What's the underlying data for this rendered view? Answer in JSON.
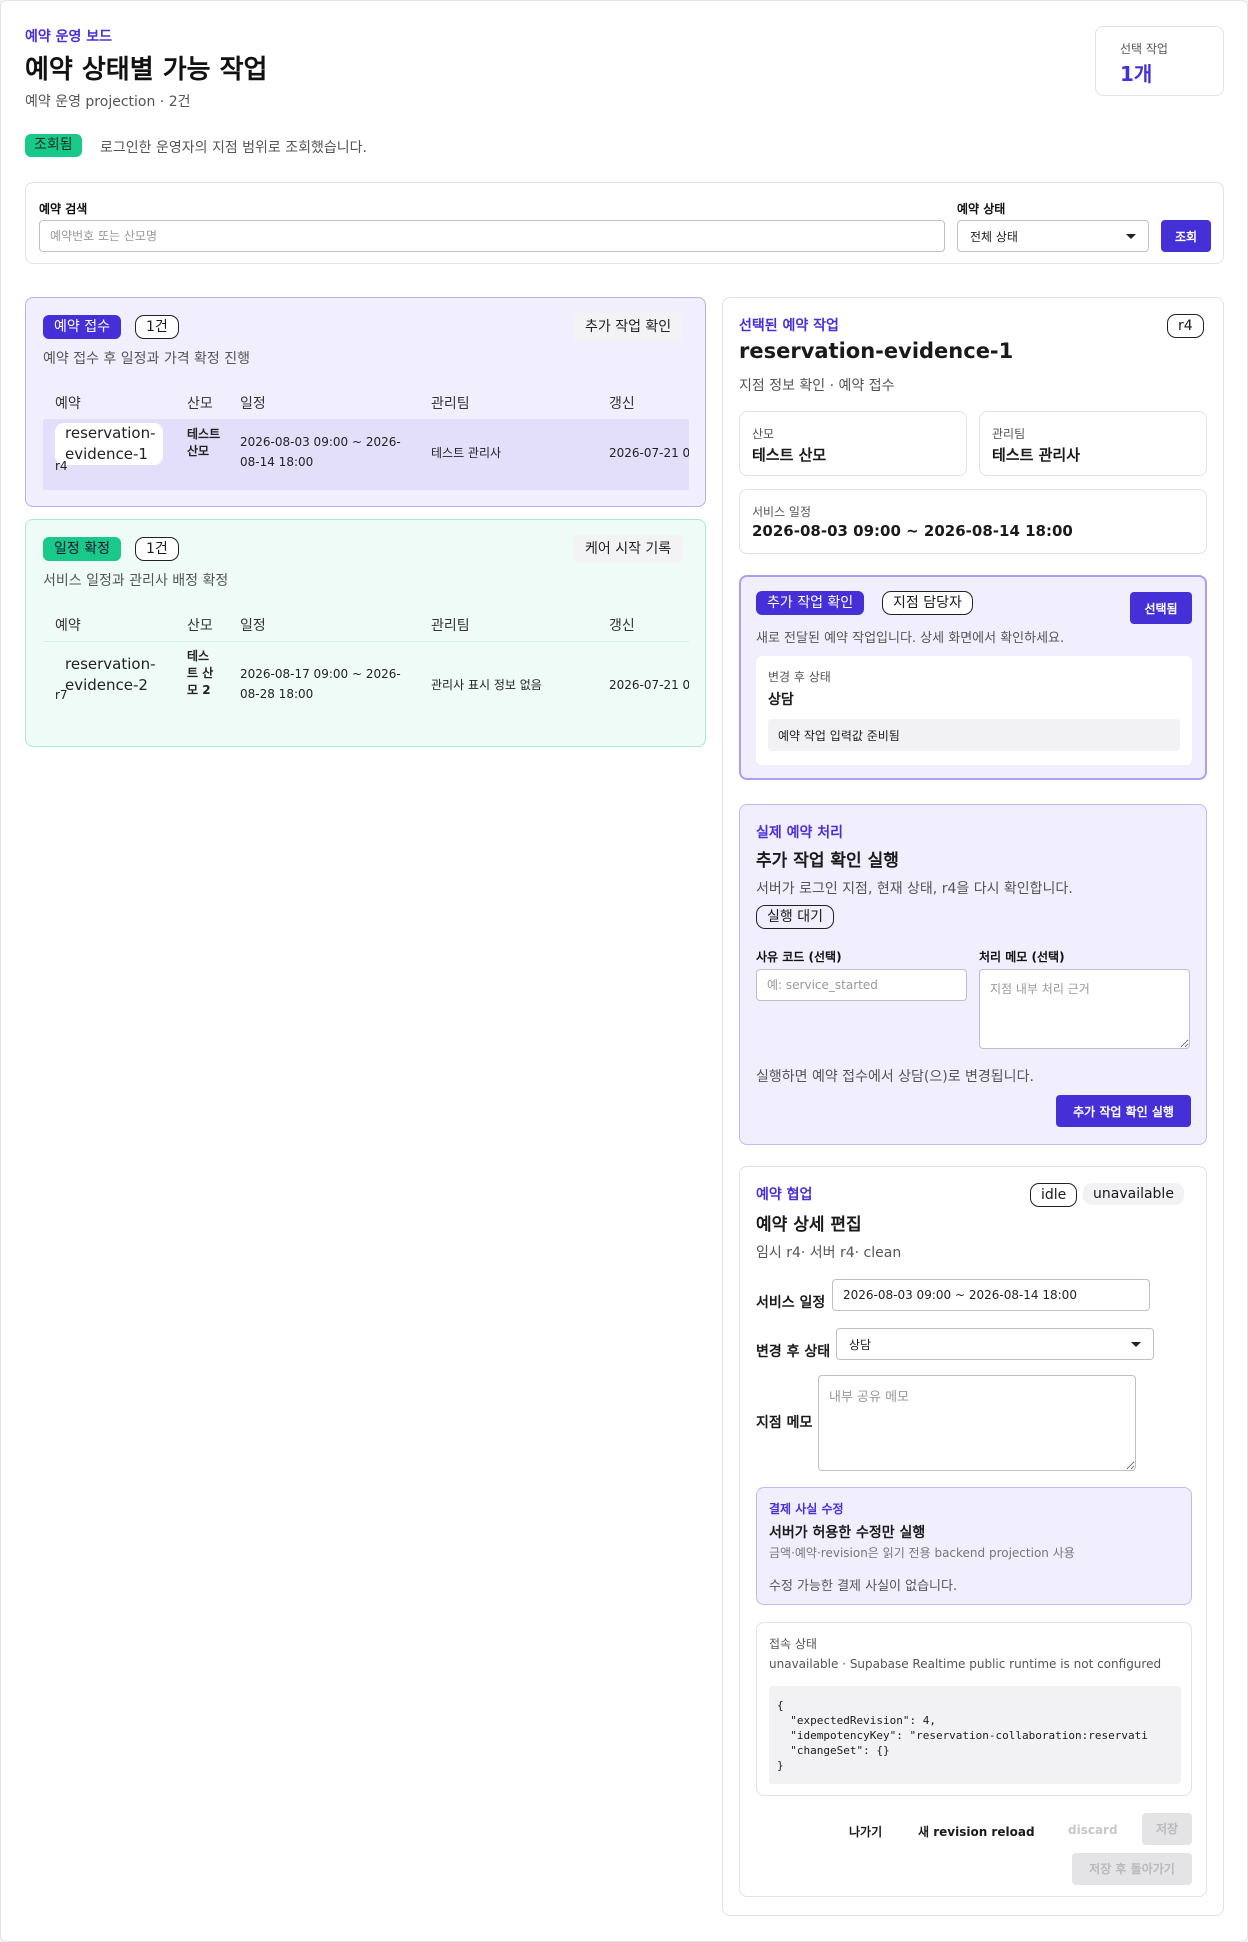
{
  "header": {
    "eyebrow": "예약 운영 보드",
    "title": "예약 상태별 가능 작업",
    "subtitle": "예약 운영 projection · 2건",
    "selected_label": "선택 작업",
    "selected_value": "1개"
  },
  "status": {
    "badge": "조회됨",
    "message": "로그인한 운영자의 지점 범위로 조회했습니다."
  },
  "filters": {
    "search_label": "예약 검색",
    "search_placeholder": "예약번호 또는 산모명",
    "status_label": "예약 상태",
    "status_value": "전체 상태",
    "submit": "조회"
  },
  "groups": [
    {
      "badge": "예약 접수",
      "count": "1건",
      "action": "추가 작업 확인",
      "description": "예약 접수 후 일정과 가격 확정 진행",
      "columns": [
        "예약",
        "산모",
        "일정",
        "관리팀",
        "갱신"
      ],
      "rows": [
        {
          "id": "reservation-evidence-1",
          "revision": "r4",
          "mother": "테스트 산모",
          "schedule": "2026-08-03 09:00 ~ 2026-08-14 18:00",
          "team": "테스트 관리사",
          "updated": "2026-07-21 0"
        }
      ]
    },
    {
      "badge": "일정 확정",
      "count": "1건",
      "action": "케어 시작 기록",
      "description": "서비스 일정과 관리사 배정 확정",
      "columns": [
        "예약",
        "산모",
        "일정",
        "관리팀",
        "갱신"
      ],
      "rows": [
        {
          "id": "reservation-evidence-2",
          "revision": "r7",
          "mother": "테스트 산모 2",
          "schedule": "2026-08-17 09:00 ~ 2026-08-28 18:00",
          "team": "관리사 표시 정보 없음",
          "updated": "2026-07-21 0"
        }
      ]
    }
  ],
  "detail": {
    "eyebrow": "선택된 예약 작업",
    "revision": "r4",
    "title": "reservation-evidence-1",
    "subtitle": "지점 정보 확인 · 예약 접수",
    "mother_label": "산모",
    "mother_value": "테스트 산모",
    "team_label": "관리팀",
    "team_value": "테스트 관리사",
    "schedule_label": "서비스 일정",
    "schedule_value": "2026-08-03 09:00 ~ 2026-08-14 18:00"
  },
  "task": {
    "badge": "추가 작업 확인",
    "role": "지점 담당자",
    "selected": "선택됨",
    "description": "새로 전달된 예약 작업입니다. 상세 화면에서 확인하세요.",
    "after_label": "변경 후 상태",
    "after_value": "상담",
    "note": "예약 작업 입력값 준비됨"
  },
  "execute": {
    "eyebrow": "실제 예약 처리",
    "title": "추가 작업 확인 실행",
    "description": "서버가 로그인 지점, 현재 상태, r4을 다시 확인합니다.",
    "state": "실행 대기",
    "reason_label": "사유 코드 (선택)",
    "reason_placeholder": "예: service_started",
    "memo_label": "처리 메모 (선택)",
    "memo_placeholder": "지점 내부 처리 근거",
    "result_note": "실행하면 예약 접수에서 상담(으)로 변경됩니다.",
    "submit": "추가 작업 확인 실행"
  },
  "collab": {
    "eyebrow": "예약 협업",
    "state": "idle",
    "availability": "unavailable",
    "title": "예약 상세 편집",
    "subtitle": "임시 r4· 서버 r4· clean",
    "schedule_label": "서비스 일정",
    "schedule_value": "2026-08-03 09:00 ~ 2026-08-14 18:00",
    "after_label": "변경 후 상태",
    "after_value": "상담",
    "memo_label": "지점 메모",
    "memo_placeholder": "내부 공유 메모",
    "payment": {
      "eyebrow": "결제 사실 수정",
      "title": "서버가 허용한 수정만 실행",
      "subtitle": "금액·예약·revision은 읽기 전용 backend projection 사용",
      "empty": "수정 가능한 결제 사실이 없습니다."
    },
    "connection": {
      "label": "접속 상태",
      "value": "unavailable · Supabase Realtime public runtime is not configured",
      "json_lines": [
        "{",
        "  \"expectedRevision\": 4,",
        "  \"idempotencyKey\": \"reservation-collaboration:reservati",
        "  \"changeSet\": {}",
        "}"
      ]
    },
    "actions": {
      "leave": "나가기",
      "reload": "새 revision reload",
      "discard": "discard",
      "save": "저장",
      "save_back": "저장 후 돌아가기"
    }
  }
}
